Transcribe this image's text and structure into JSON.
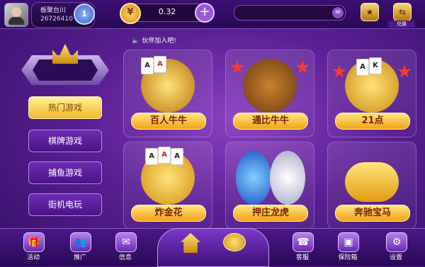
{
  "header": {
    "player_name": "板聚台川",
    "player_id": "26726410",
    "level": "1",
    "coins": "0.32",
    "top_icons": [
      {
        "label": "",
        "icon": "trophy-icon"
      },
      {
        "label": "兑换",
        "icon": "exchange-icon"
      }
    ]
  },
  "announcement": "伙伴加入吧!",
  "sidebar": {
    "items": [
      {
        "label": "热门游戏",
        "active": true
      },
      {
        "label": "棋牌游戏",
        "active": false
      },
      {
        "label": "捕鱼游戏",
        "active": false
      },
      {
        "label": "街机电玩",
        "active": false
      }
    ]
  },
  "games": [
    {
      "label": "百人牛牛",
      "icon": "golden-bull-icon"
    },
    {
      "label": "通比牛牛",
      "icon": "sunglasses-bull-icon"
    },
    {
      "label": "21点",
      "icon": "blackjack-chips-icon"
    },
    {
      "label": "炸金花",
      "icon": "golden-flower-icon"
    },
    {
      "label": "押庄龙虎",
      "icon": "dragon-tiger-icon"
    },
    {
      "label": "奔驰宝马",
      "icon": "race-car-icon"
    }
  ],
  "bottom_nav": [
    {
      "label": "活动",
      "icon": "gift-icon"
    },
    {
      "label": "推广",
      "icon": "people-icon"
    },
    {
      "label": "信息",
      "icon": "mail-icon"
    },
    {
      "label": "客服",
      "icon": "support-icon"
    },
    {
      "label": "保险箱",
      "icon": "safe-icon"
    },
    {
      "label": "设置",
      "icon": "gear-icon"
    }
  ],
  "colors": {
    "background": "#5a1f93",
    "accent_gold": "#f2a218",
    "tile_label_text": "#7b2500"
  }
}
